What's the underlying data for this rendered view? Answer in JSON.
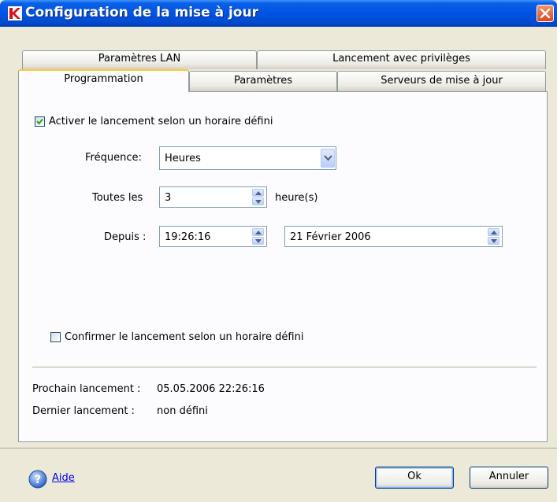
{
  "window": {
    "title": "Configuration de la mise à jour",
    "app_icon": "kaspersky-k-icon",
    "close_icon": "close-icon"
  },
  "tabs": {
    "row1": [
      {
        "label": "Paramètres LAN"
      },
      {
        "label": "Lancement avec privilèges"
      }
    ],
    "row2": [
      {
        "label": "Programmation",
        "active": true
      },
      {
        "label": "Paramètres"
      },
      {
        "label": "Serveurs de mise à jour"
      }
    ]
  },
  "schedule": {
    "enable_label": "Activer le lancement selon un horaire défini",
    "enable_checked": true,
    "frequency_label": "Fréquence:",
    "frequency_value": "Heures",
    "every_label": "Toutes les",
    "every_value": "3",
    "every_unit": "heure(s)",
    "since_label": "Depuis :",
    "since_time": "19:26:16",
    "since_date": "21 Février 2006",
    "confirm_label": "Confirmer le lancement selon un horaire défini",
    "confirm_checked": false
  },
  "info": {
    "next_label": "Prochain lancement :",
    "next_value": "05.05.2006 22:26:16",
    "last_label": "Dernier lancement :",
    "last_value": "non défini"
  },
  "footer": {
    "help_label": "Aide",
    "ok_label": "Ok",
    "cancel_label": "Annuler"
  }
}
